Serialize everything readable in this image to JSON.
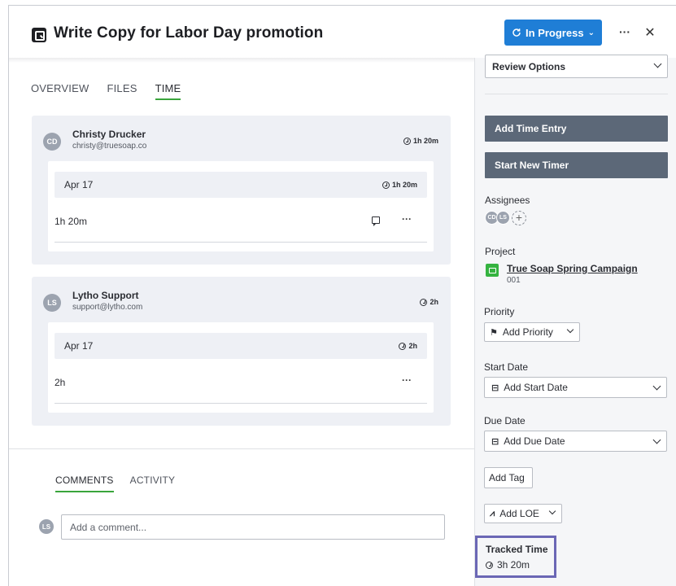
{
  "header": {
    "title": "Write Copy for Labor Day promotion",
    "status_label": "In Progress",
    "more_label": "···",
    "close_label": "✕"
  },
  "tabs": [
    {
      "label": "OVERVIEW",
      "active": false
    },
    {
      "label": "FILES",
      "active": false
    },
    {
      "label": "TIME",
      "active": true
    }
  ],
  "time_entries": [
    {
      "initials": "CD",
      "name": "Christy Drucker",
      "email": "christy@truesoap.co",
      "total": "1h 20m",
      "date": "Apr 17",
      "date_total": "1h 20m",
      "duration": "1h 20m",
      "has_comment": true
    },
    {
      "initials": "LS",
      "name": "Lytho Support",
      "email": "support@lytho.com",
      "total": "2h",
      "date": "Apr 17",
      "date_total": "2h",
      "duration": "2h",
      "has_comment": false
    }
  ],
  "comments": {
    "tabs": [
      {
        "label": "COMMENTS",
        "active": true
      },
      {
        "label": "ACTIVITY",
        "active": false
      }
    ],
    "user_initials": "LS",
    "placeholder": "Add a comment..."
  },
  "sidebar": {
    "review_options": "Review Options",
    "add_time_entry": "Add Time Entry",
    "start_new_timer": "Start New Timer",
    "assignees_label": "Assignees",
    "assignees": [
      "CD",
      "LS"
    ],
    "add_assignee": "+",
    "project_label": "Project",
    "project_name": "True Soap Spring Campaign",
    "project_number": "001",
    "priority_label": "Priority",
    "add_priority": "Add Priority",
    "start_date_label": "Start Date",
    "add_start_date": "Add Start Date",
    "due_date_label": "Due Date",
    "add_due_date": "Add Due Date",
    "add_tag": "Add Tag",
    "add_loe": "Add LOE",
    "tracked_time_label": "Tracked Time",
    "tracked_time": "3h 20m"
  },
  "colors": {
    "accent_blue": "#1f7ed6",
    "active_tab_green": "#3aa53c",
    "dark_button": "#5c6878",
    "project_green": "#35b340",
    "highlight_border": "#6b67b5"
  },
  "icons": {
    "task": "task-icon",
    "status": "refresh-icon",
    "clock": "clock-icon",
    "comment": "comment-icon",
    "flag": "flag-icon",
    "calendar": "calendar-icon",
    "loe": "loe-icon",
    "folder": "folder-icon"
  }
}
